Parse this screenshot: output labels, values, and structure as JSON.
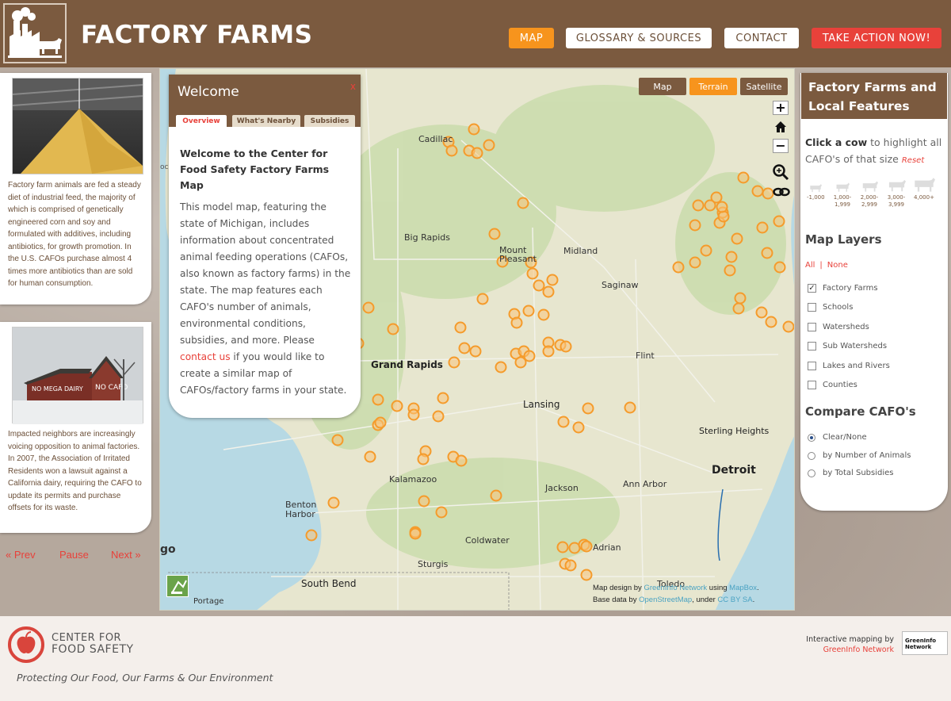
{
  "header": {
    "title": "FACTORY FARMS",
    "nav": {
      "map": "MAP",
      "glossary": "GLOSSARY & SOURCES",
      "contact": "CONTACT",
      "action": "TAKE ACTION NOW!"
    }
  },
  "left_panel": {
    "card1_text": "Factory farm animals are fed a steady diet of industrial feed, the majority of which is comprised of genetically engineered corn and soy and formulated with additives, including antibiotics, for growth promotion. In the U.S. CAFOs purchase almost 4 times more antibiotics than are sold for human consumption.",
    "card2_text": "Impacted neighbors are increasingly voicing opposition to animal factories. In 2007, the Association of Irritated Residents won a lawsuit against a California dairy, requiring the CAFO to update its permits and purchase offsets for its waste.",
    "barn_sign_1": "NO MEGA DAIRY",
    "barn_sign_2": "NO CAFO",
    "prev": "« Prev",
    "pause": "Pause",
    "next": "Next »"
  },
  "map": {
    "basemaps": {
      "map": "Map",
      "terrain": "Terrain",
      "satellite": "Satellite"
    },
    "zoom_in": "+",
    "zoom_out": "−",
    "labels": [
      "Cadillac",
      "Big Rapids",
      "Mount Pleasant",
      "Midland",
      "Saginaw",
      "Grand Rapids",
      "Flint",
      "Lansing",
      "Sterling Heights",
      "Detroit",
      "Kalamazoo",
      "Jackson",
      "Ann Arbor",
      "Benton Harbor",
      "Coldwater",
      "Adrian",
      "Sturgis",
      "South Bend",
      "Toledo",
      "Portage"
    ],
    "edge_label_left": "go",
    "edge_label_oc": "oc",
    "credits": {
      "line1_pre": "Map design by ",
      "line1_link1": "GreenInfo Network",
      "line1_mid": " using ",
      "line1_link2": "MapBox",
      "line1_post": ".",
      "line2_pre": "Base data by ",
      "line2_link1": "OpenStreetMap",
      "line2_mid": ", under ",
      "line2_link2": "CC BY SA",
      "line2_post": "."
    }
  },
  "welcome": {
    "title": "Welcome",
    "close": "x",
    "tabs": {
      "overview": "Overview",
      "nearby": "What's Nearby",
      "subsidies": "Subsidies"
    },
    "heading": "Welcome to the Center for Food Safety Factory Farms Map",
    "body_pre": "This model map, featuring the state of Michigan, includes information about concentrated animal feeding operations (CAFOs, also known as factory farms) in the state. The map features each CAFO's number of animals, environmental conditions, subsidies, and more. Please ",
    "body_link": "contact us",
    "body_post": " if you would like to create a similar map of CAFOs/factory farms in your state."
  },
  "right_panel": {
    "title": "Factory Farms and Local Features",
    "instr_bold": "Click a cow",
    "instr_rest": " to highlight all CAFO's of that size",
    "reset": "Reset",
    "cows": [
      "-1,000",
      "1,000-1,999",
      "2,000-2,999",
      "3,000-3,999",
      "4,000+"
    ],
    "layers_heading": "Map Layers",
    "all": "All",
    "sep": "|",
    "none": "None",
    "layers": [
      {
        "label": "Factory Farms",
        "checked": true
      },
      {
        "label": "Schools",
        "checked": false
      },
      {
        "label": "Watersheds",
        "checked": false
      },
      {
        "label": "Sub Watersheds",
        "checked": false
      },
      {
        "label": "Lakes and Rivers",
        "checked": false
      },
      {
        "label": "Counties",
        "checked": false
      }
    ],
    "compare_heading": "Compare CAFO's",
    "compare_options": [
      {
        "label": "Clear/None",
        "selected": true
      },
      {
        "label": "by Number of Animals",
        "selected": false
      },
      {
        "label": "by Total Subsidies",
        "selected": false
      }
    ]
  },
  "footer": {
    "org_line1": "CENTER FOR",
    "org_line2": "FOOD SAFETY",
    "tagline": "Protecting Our Food, Our Farms & Our Environment",
    "mapping_by": "Interactive mapping by",
    "mapping_link": "GreenInfo Network",
    "gi_logo_line1": "GreenInfo",
    "gi_logo_line2": "Network"
  },
  "colors": {
    "brown": "#7b5a3f",
    "orange": "#f7941d",
    "red": "#e8413a",
    "cafo_marker": "#f7a83c"
  }
}
